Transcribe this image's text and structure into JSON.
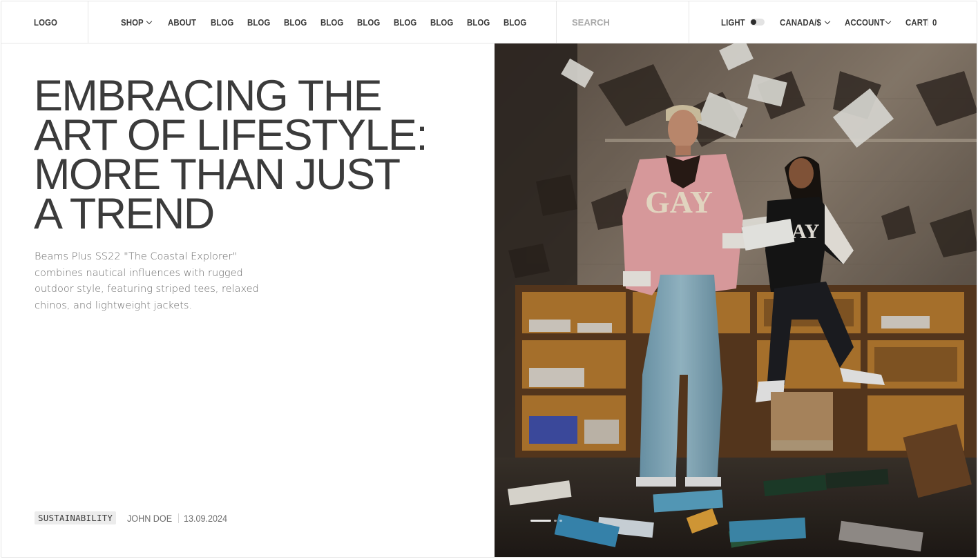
{
  "header": {
    "logo": "LOGO",
    "nav": [
      {
        "label": "SHOP",
        "has_dropdown": true
      },
      {
        "label": "ABOUT",
        "has_dropdown": false
      },
      {
        "label": "BLOG",
        "has_dropdown": false
      },
      {
        "label": "BLOG",
        "has_dropdown": false
      },
      {
        "label": "BLOG",
        "has_dropdown": false
      },
      {
        "label": "BLOG",
        "has_dropdown": false
      },
      {
        "label": "BLOG",
        "has_dropdown": false
      },
      {
        "label": "BLOG",
        "has_dropdown": false
      },
      {
        "label": "BLOG",
        "has_dropdown": false
      },
      {
        "label": "BLOG",
        "has_dropdown": false
      },
      {
        "label": "BLOG",
        "has_dropdown": false
      }
    ],
    "search_placeholder": "SEARCH",
    "theme_label": "LIGHT",
    "region_label": "CANADA/$",
    "account_label": "ACCOUNT",
    "cart_label": "CART",
    "cart_count": "0"
  },
  "article": {
    "headline_lines": [
      "EMBRACING THE",
      "ART OF LIFESTYLE:",
      "MORE THAN JUST",
      "A TREND"
    ],
    "description": "Beams Plus SS22 \"The Coastal Explorer\" combines nautical influences with rugged outdoor style, featuring striped tees, relaxed chinos, and lightweight jackets.",
    "tag": "SUSTAINABILITY",
    "author": "JOHN DOE",
    "date": "13.09.2024"
  },
  "hero_image": {
    "slide_count": 3,
    "active_slide": 1,
    "jacket_lettering_left": "GAY",
    "jacket_lettering_right": "AY"
  },
  "colors": {
    "text_dark": "#3b3b3b",
    "text_muted": "#6b6b6b",
    "border": "#e6e6e6",
    "tag_bg": "#ececec"
  }
}
